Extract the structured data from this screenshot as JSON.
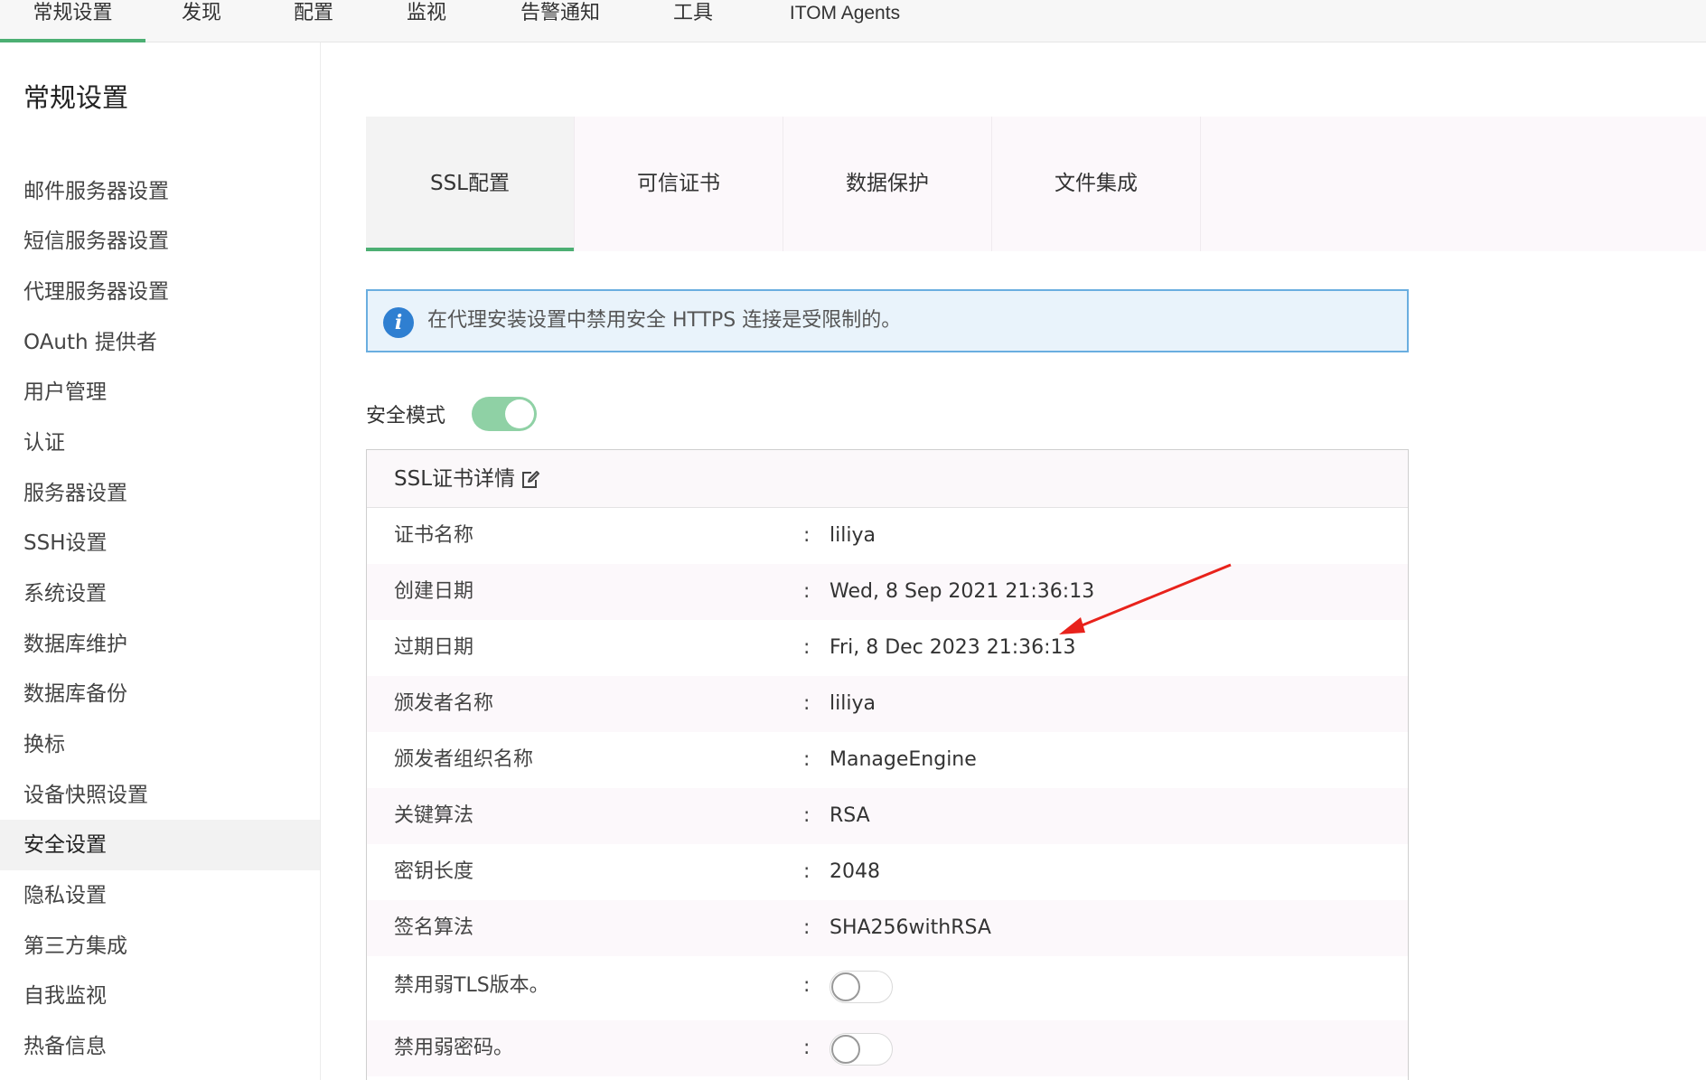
{
  "topnav": {
    "items": [
      "常规设置",
      "发现",
      "配置",
      "监视",
      "告警通知",
      "工具",
      "ITOM Agents"
    ],
    "active_index": 0
  },
  "sidebar": {
    "title": "常规设置",
    "items": [
      "邮件服务器设置",
      "短信服务器设置",
      "代理服务器设置",
      "OAuth 提供者",
      "用户管理",
      "认证",
      "服务器设置",
      "SSH设置",
      "系统设置",
      "数据库维护",
      "数据库备份",
      "换标",
      "设备快照设置",
      "安全设置",
      "隐私设置",
      "第三方集成",
      "自我监视",
      "热备信息"
    ],
    "active_index": 13
  },
  "tabs": {
    "items": [
      "SSL配置",
      "可信证书",
      "数据保护",
      "文件集成"
    ],
    "active_index": 0
  },
  "alert": {
    "icon": "info-icon",
    "text": "在代理安装设置中禁用安全 HTTPS 连接是受限制的。"
  },
  "secure_mode": {
    "label": "安全模式",
    "enabled": true
  },
  "cert_panel": {
    "title": "SSL证书详情",
    "edit_icon": "edit-icon",
    "colon": ":",
    "rows": [
      {
        "label": "证书名称",
        "value": "liliya"
      },
      {
        "label": "创建日期",
        "value": "Wed, 8 Sep 2021 21:36:13"
      },
      {
        "label": "过期日期",
        "value": "Fri, 8 Dec 2023 21:36:13"
      },
      {
        "label": "颁发者名称",
        "value": "liliya"
      },
      {
        "label": "颁发者组织名称",
        "value": "ManageEngine"
      },
      {
        "label": "关键算法",
        "value": "RSA"
      },
      {
        "label": "密钥长度",
        "value": "2048"
      },
      {
        "label": "签名算法",
        "value": "SHA256withRSA"
      }
    ],
    "toggle_rows": [
      {
        "label": "禁用弱TLS版本。",
        "enabled": false
      },
      {
        "label": "禁用弱密码。",
        "enabled": false
      }
    ]
  },
  "annotation": {
    "arrow_color": "#e8221b"
  },
  "colors": {
    "accent_green": "#4caf73",
    "toggle_on": "#8fd1a5",
    "info_blue": "#2f7fd1",
    "alert_border": "#6aaee0"
  }
}
